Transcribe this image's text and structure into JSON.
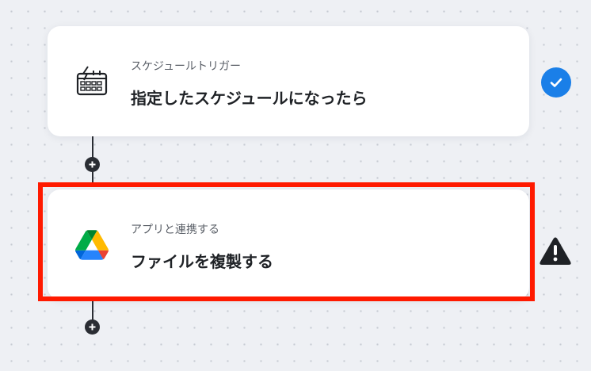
{
  "flow": {
    "steps": [
      {
        "subtitle": "スケジュールトリガー",
        "title": "指定したスケジュールになったら",
        "icon": "schedule-calendar-icon",
        "status": "complete"
      },
      {
        "subtitle": "アプリと連携する",
        "title": "ファイルを複製する",
        "icon": "google-drive-icon",
        "status": "warning"
      }
    ]
  },
  "colors": {
    "canvas": "#eef0f4",
    "card": "#ffffff",
    "connector": "#2a2d33",
    "check_badge": "#1a7fe8",
    "warning": "#1f2226",
    "highlight_frame": "#ff1a00"
  }
}
